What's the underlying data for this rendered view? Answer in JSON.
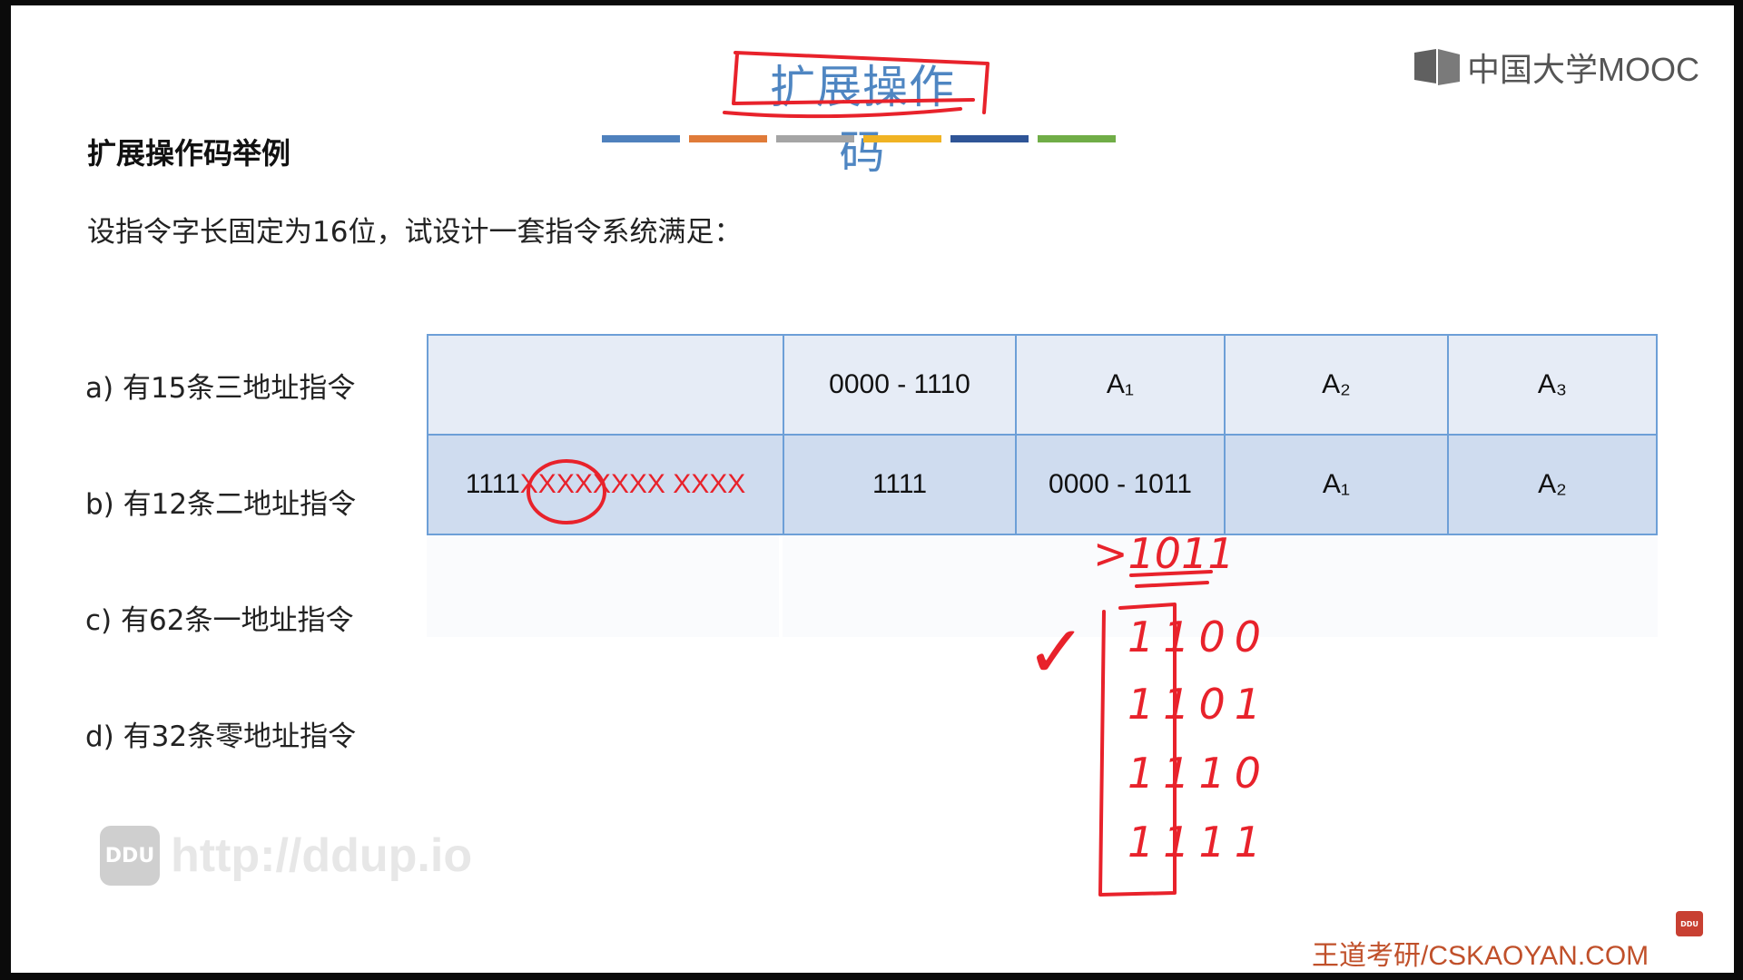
{
  "slide": {
    "title": "扩展操作码",
    "brand": "中国大学MOOC",
    "heading": "扩展操作码举例",
    "intro": "设指令字长固定为16位，试设计一套指令系统满足：",
    "requirements": [
      "a) 有15条三地址指令",
      "b) 有12条二地址指令",
      "c) 有62条一地址指令",
      "d) 有32条零地址指令"
    ],
    "colorbar": [
      "#4f81bd",
      "#e07b39",
      "#a5a5a5",
      "#f0b323",
      "#2f5597",
      "#70ad47"
    ]
  },
  "table": {
    "row1": {
      "c1": "",
      "c2": "0000 - 1110",
      "c3": "A₁",
      "c4": "A₂",
      "c5": "A₃"
    },
    "row2": {
      "c1_prefix": "1111",
      "c1_circled": "XXXX",
      "c1_rest": "XXXX XXXX",
      "c2": "1111",
      "c3": "0000 - 1011",
      "c4": "A₁",
      "c5": "A₂"
    }
  },
  "annotations": {
    "first_line": ">1011",
    "opcodes": [
      "1100",
      "1101",
      "1110",
      "1111"
    ],
    "mark": "✓"
  },
  "watermark": {
    "logo": "DDU",
    "url": "http://ddup.io"
  },
  "footer": {
    "text": "王道考研/CSKAOYAN.COM",
    "corner_icon": "DDU"
  }
}
